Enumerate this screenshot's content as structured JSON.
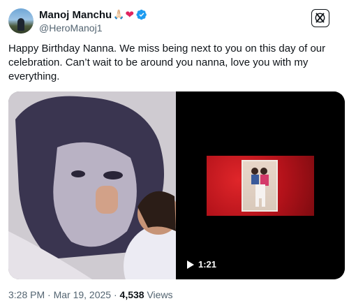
{
  "author": {
    "display_name": "Manoj Manchu",
    "handle": "@HeroManoj1",
    "emoji_hands": "🙏🏻",
    "emoji_heart": "❤",
    "verified": true
  },
  "tweet": {
    "text": "Happy Birthday Nanna. We miss being next to you on this day of our celebration. Can’t wait to be around you nanna, love you with my everything."
  },
  "media": {
    "video": {
      "duration": "1:21"
    }
  },
  "meta": {
    "time_date": "3:28 PM · Mar 19, 2025 · ",
    "views_count": "4,538",
    "views_label": " Views"
  },
  "colors": {
    "text_primary": "#0f1419",
    "text_secondary": "#536471",
    "verified_blue": "#1d9bf0",
    "heart_red": "#e0245e"
  },
  "icons": {
    "verified": "verified-badge-icon",
    "x_logo": "x-logo-icon",
    "play": "play-icon"
  }
}
